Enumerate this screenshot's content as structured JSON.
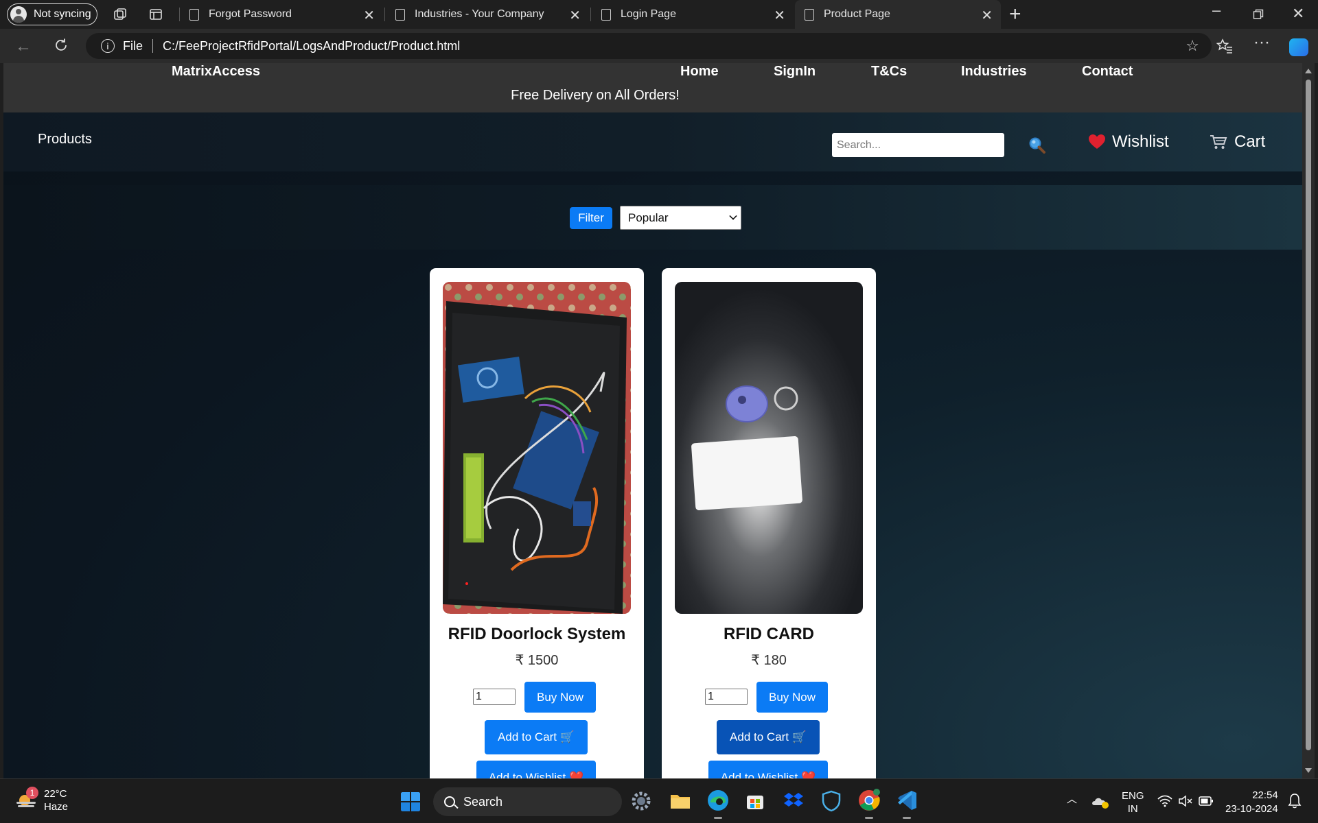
{
  "browser": {
    "profile_label": "Not syncing",
    "tabs": [
      {
        "title": "Forgot Password"
      },
      {
        "title": "Industries - Your Company"
      },
      {
        "title": "Login Page"
      },
      {
        "title": "Product Page"
      }
    ],
    "address": {
      "scheme": "File",
      "url": "C:/FeeProjectRfidPortal/LogsAndProduct/Product.html"
    }
  },
  "site": {
    "brand": "MatrixAccess",
    "nav": [
      "Home",
      "SignIn",
      "T&Cs",
      "Industries",
      "Contact"
    ],
    "promo": "Free Delivery on All Orders!",
    "section_title": "Products",
    "search_placeholder": "Search...",
    "wishlist_label": "Wishlist",
    "cart_label": "Cart",
    "filter_label": "Filter",
    "sort_selected": "Popular"
  },
  "products": [
    {
      "name": "RFID Doorlock System",
      "price": "₹ 1500",
      "quantity": "1",
      "buy_label": "Buy Now",
      "add_cart_label": "Add to Cart 🛒",
      "add_wishlist_label": "Add to Wishlist ❤️"
    },
    {
      "name": "RFID CARD",
      "price": "₹ 180",
      "quantity": "1",
      "buy_label": "Buy Now",
      "add_cart_label": "Add to Cart 🛒",
      "add_wishlist_label": "Add to Wishlist ❤️"
    }
  ],
  "taskbar": {
    "weather_temp": "22°C",
    "weather_desc": "Haze",
    "weather_badge": "1",
    "search_label": "Search",
    "lang_primary": "ENG",
    "lang_secondary": "IN",
    "time": "22:54",
    "date": "23-10-2024"
  },
  "colors": {
    "accent_button": "#0b7bf5",
    "header_bg": "#333333",
    "page_bg": "#0c1620"
  }
}
